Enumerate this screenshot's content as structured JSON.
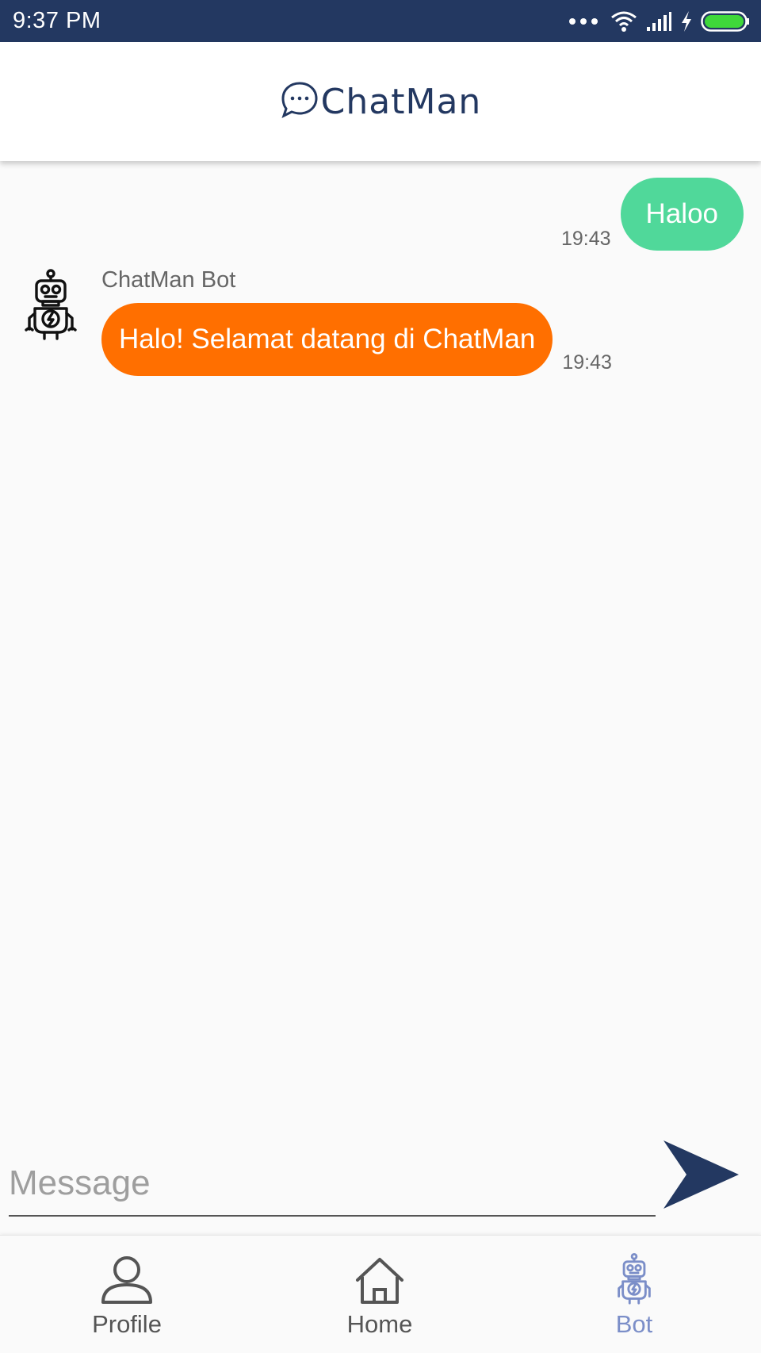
{
  "status_bar": {
    "time": "9:37 PM",
    "icons": [
      "more-dots-icon",
      "wifi-icon",
      "signal-icon",
      "charging-icon",
      "battery-icon"
    ]
  },
  "header": {
    "title": "ChatMan",
    "logo_icon": "chat-bubble-icon"
  },
  "chat": {
    "messages": [
      {
        "direction": "outgoing",
        "text": "Haloo",
        "time": "19:43"
      },
      {
        "direction": "incoming",
        "sender": "ChatMan Bot",
        "text": "Halo! Selamat datang di ChatMan",
        "time": "19:43",
        "avatar_icon": "robot-icon"
      }
    ]
  },
  "composer": {
    "placeholder": "Message",
    "value": "",
    "send_icon": "send-arrow-icon"
  },
  "nav": {
    "items": [
      {
        "label": "Profile",
        "icon": "person-icon",
        "active": false
      },
      {
        "label": "Home",
        "icon": "home-icon",
        "active": false
      },
      {
        "label": "Bot",
        "icon": "robot-icon",
        "active": true
      }
    ]
  },
  "colors": {
    "primary": "#233861",
    "outgoing_bubble": "#50d89a",
    "incoming_bubble": "#ff6f00",
    "active_nav": "#7b8ec8",
    "battery": "#3fd83a"
  }
}
